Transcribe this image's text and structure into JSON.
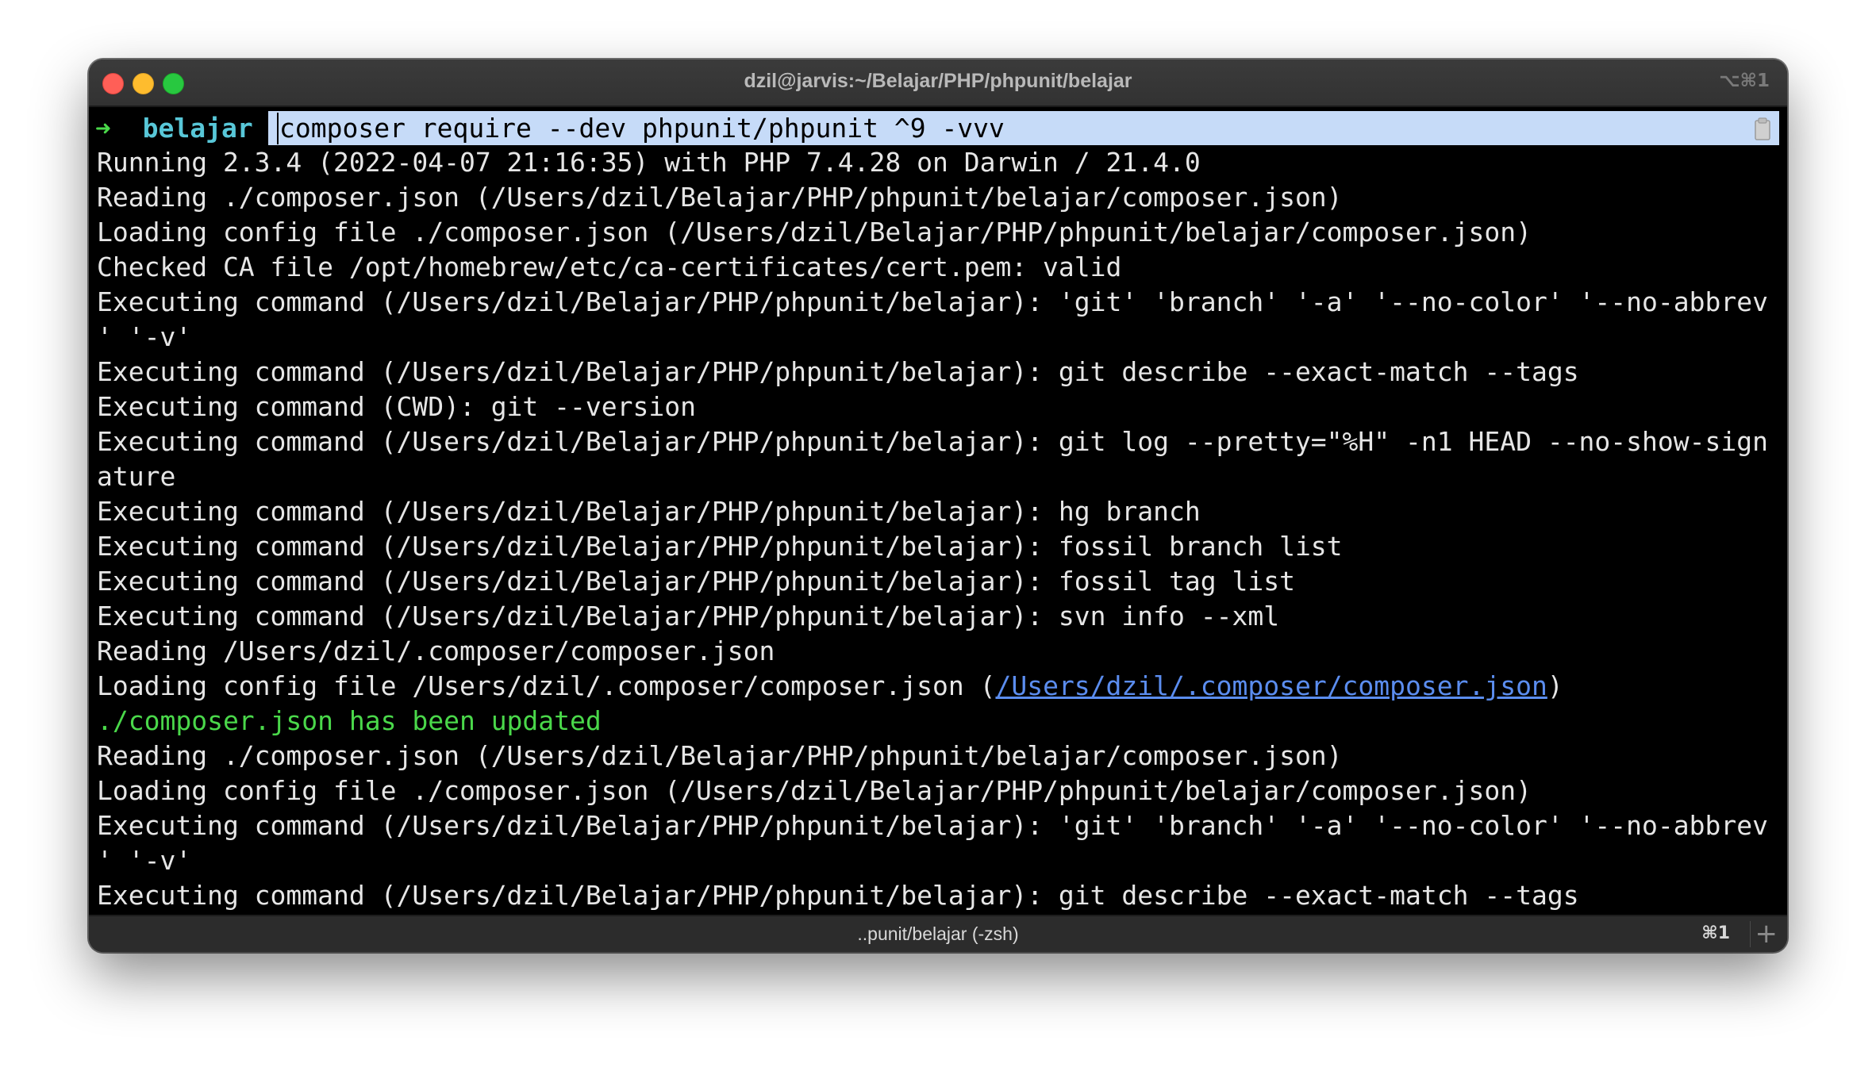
{
  "window": {
    "title": "dzil@jarvis:~/Belajar/PHP/phpunit/belajar",
    "shortcut": "⌥⌘1"
  },
  "prompt": {
    "arrow": "➜",
    "directory": "belajar",
    "command": "composer require --dev phpunit/phpunit ^9 -vvv"
  },
  "output": {
    "l01": "Running 2.3.4 (2022-04-07 21:16:35) with PHP 7.4.28 on Darwin / 21.4.0",
    "l02": "Reading ./composer.json (/Users/dzil/Belajar/PHP/phpunit/belajar/composer.json)",
    "l03": "Loading config file ./composer.json (/Users/dzil/Belajar/PHP/phpunit/belajar/composer.json)",
    "l04": "Checked CA file /opt/homebrew/etc/ca-certificates/cert.pem: valid",
    "l05": "Executing command (/Users/dzil/Belajar/PHP/phpunit/belajar): 'git' 'branch' '-a' '--no-color' '--no-abbrev",
    "l06": "' '-v'",
    "l07": "Executing command (/Users/dzil/Belajar/PHP/phpunit/belajar): git describe --exact-match --tags",
    "l08": "Executing command (CWD): git --version",
    "l09": "Executing command (/Users/dzil/Belajar/PHP/phpunit/belajar): git log --pretty=\"%H\" -n1 HEAD --no-show-sign",
    "l10": "ature",
    "l11": "Executing command (/Users/dzil/Belajar/PHP/phpunit/belajar): hg branch",
    "l12": "Executing command (/Users/dzil/Belajar/PHP/phpunit/belajar): fossil branch list",
    "l13": "Executing command (/Users/dzil/Belajar/PHP/phpunit/belajar): fossil tag list",
    "l14": "Executing command (/Users/dzil/Belajar/PHP/phpunit/belajar): svn info --xml",
    "l15": "Reading /Users/dzil/.composer/composer.json",
    "l16_prefix": "Loading config file /Users/dzil/.composer/composer.json (",
    "l16_link": "/Users/dzil/.composer/composer.json",
    "l16_suffix": ")",
    "l17": "./composer.json has been updated",
    "l18": "Reading ./composer.json (/Users/dzil/Belajar/PHP/phpunit/belajar/composer.json)",
    "l19": "Loading config file ./composer.json (/Users/dzil/Belajar/PHP/phpunit/belajar/composer.json)",
    "l20": "Executing command (/Users/dzil/Belajar/PHP/phpunit/belajar): 'git' 'branch' '-a' '--no-color' '--no-abbrev",
    "l21": "' '-v'",
    "l22": "Executing command (/Users/dzil/Belajar/PHP/phpunit/belajar): git describe --exact-match --tags"
  },
  "tabbar": {
    "tab_title": "..punit/belajar (-zsh)",
    "tab_shortcut": "⌘1",
    "new_tab": "+"
  },
  "colors": {
    "prompt_dir": "#58c7d8",
    "prompt_arrow": "#4ad84a",
    "selection": "#c6dbf8",
    "success_text": "#4ad84a",
    "link": "#5b8def"
  }
}
